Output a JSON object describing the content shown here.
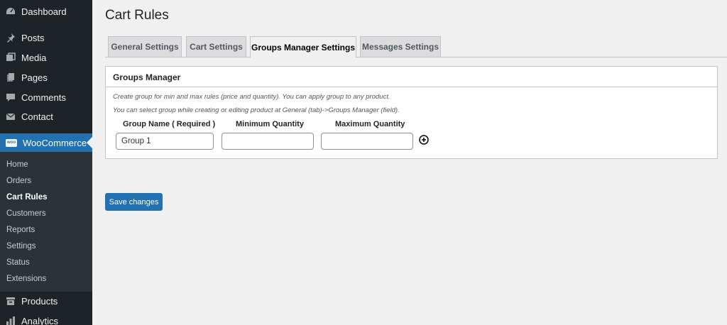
{
  "sidebar": {
    "top_items": [
      {
        "label": "Dashboard",
        "icon": "dashboard-icon"
      },
      {
        "label": "Posts",
        "icon": "pushpin-icon"
      },
      {
        "label": "Media",
        "icon": "media-icon"
      },
      {
        "label": "Pages",
        "icon": "pages-icon"
      },
      {
        "label": "Comments",
        "icon": "comments-icon"
      },
      {
        "label": "Contact",
        "icon": "envelope-icon"
      }
    ],
    "active_item": {
      "label": "WooCommerce",
      "icon": "woocommerce-icon",
      "icon_text": "woo"
    },
    "submenu": [
      "Home",
      "Orders",
      "Cart Rules",
      "Customers",
      "Reports",
      "Settings",
      "Status",
      "Extensions"
    ],
    "current_submenu": "Cart Rules",
    "bottom_items": [
      {
        "label": "Products",
        "icon": "archive-icon"
      },
      {
        "label": "Analytics",
        "icon": "bar-chart-icon"
      }
    ]
  },
  "page": {
    "title": "Cart Rules",
    "tabs": [
      "General Settings",
      "Cart Settings",
      "Groups Manager Settings",
      "Messages Settings"
    ],
    "active_tab": "Groups Manager Settings"
  },
  "panel": {
    "heading": "Groups Manager",
    "note1": "Create group for min and max rules (price and quantity). You can apply group to any product.",
    "note2": "You can select group while creating or editing product at General (tab)->Groups Manager (field).",
    "columns": [
      "Group Name ( Required )",
      "Minimum Quantity",
      "Maximum Quantity"
    ],
    "group_name_value": "Group 1",
    "min_qty_value": "",
    "max_qty_value": ""
  },
  "actions": {
    "save_label": "Save changes"
  },
  "colors": {
    "sidebar_bg": "#1d2327",
    "accent": "#2271b1",
    "page_bg": "#f0f0f1"
  }
}
